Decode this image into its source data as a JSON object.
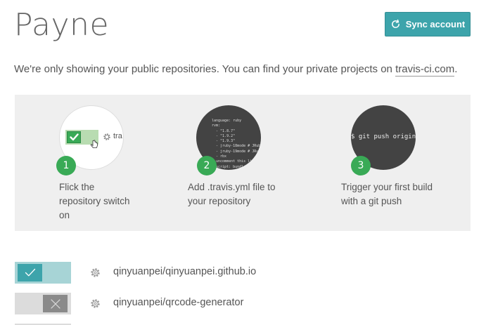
{
  "header": {
    "title": "Payne",
    "sync_button": {
      "label": "Sync account",
      "icon": "sync-icon"
    }
  },
  "notice": {
    "text": "We're only showing your public repositories. You can find your private projects on ",
    "link": "travis-ci.com",
    "suffix": "."
  },
  "onboarding": {
    "steps": [
      {
        "number": "1",
        "lines": [
          "Flick the",
          "repository switch",
          "on"
        ],
        "illustration": {
          "truncated_label": "tra"
        }
      },
      {
        "number": "2",
        "lines": [
          "Add .travis.yml file to",
          "your repository"
        ],
        "illustration": {
          "code": "language: ruby\nrvm:\n  - \"1.8.7\"\n  - \"1.9.2\"\n  - \"1.9.3\"\n  - jruby-18mode # JRuby\n  - jruby-19mode # JRuby\n  - rbx\n# uncomment this li\n# script: bundle"
        }
      },
      {
        "number": "3",
        "lines": [
          "Trigger your first build",
          "with a git push"
        ],
        "illustration": {
          "command": "$ git push origin"
        }
      }
    ]
  },
  "repositories": [
    {
      "name": "qinyuanpei/qinyuanpei.github.io",
      "enabled": true
    },
    {
      "name": "qinyuanpei/qrcode-generator",
      "enabled": false
    }
  ],
  "colors": {
    "accent": "#3da4ab",
    "step_badge": "#39aa56",
    "panel_bg": "#efefef",
    "toggle_on_track": "#a7d4d6",
    "toggle_off_track": "#dcdcdc"
  }
}
